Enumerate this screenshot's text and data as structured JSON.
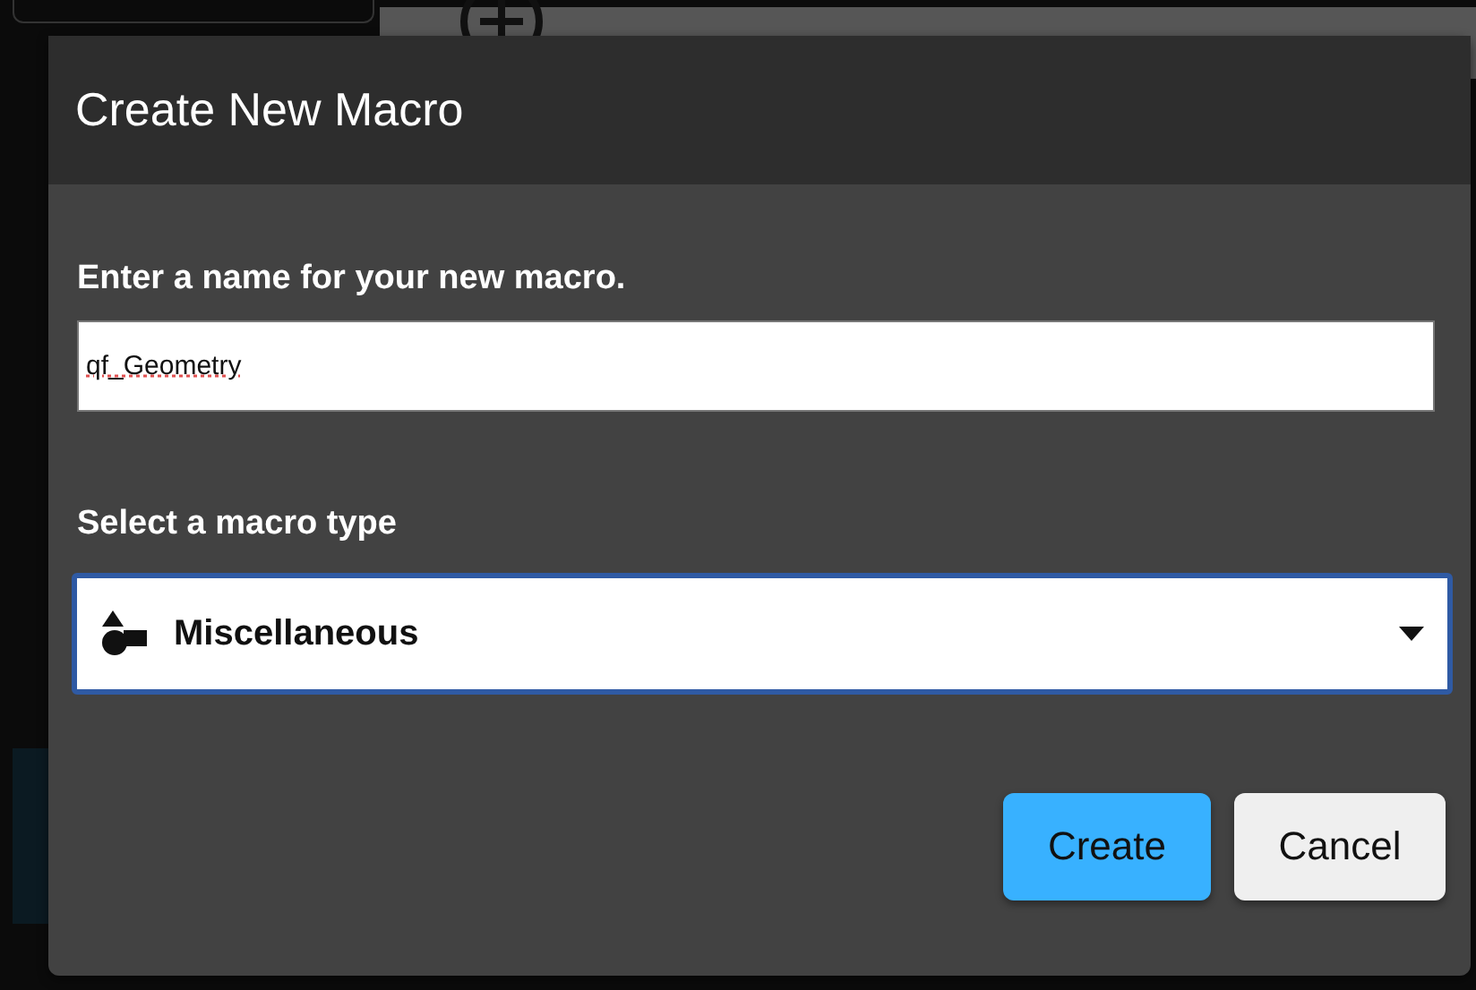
{
  "dialog": {
    "title": "Create New Macro",
    "name_label": "Enter a name for your new macro.",
    "name_field": {
      "value": "qf_Geometry"
    },
    "type_label": "Select a macro type",
    "type_select": {
      "value": "Miscellaneous"
    },
    "buttons": [
      {
        "label": "Create",
        "kind": "primary"
      },
      {
        "label": "Cancel",
        "kind": "secondary"
      }
    ]
  }
}
